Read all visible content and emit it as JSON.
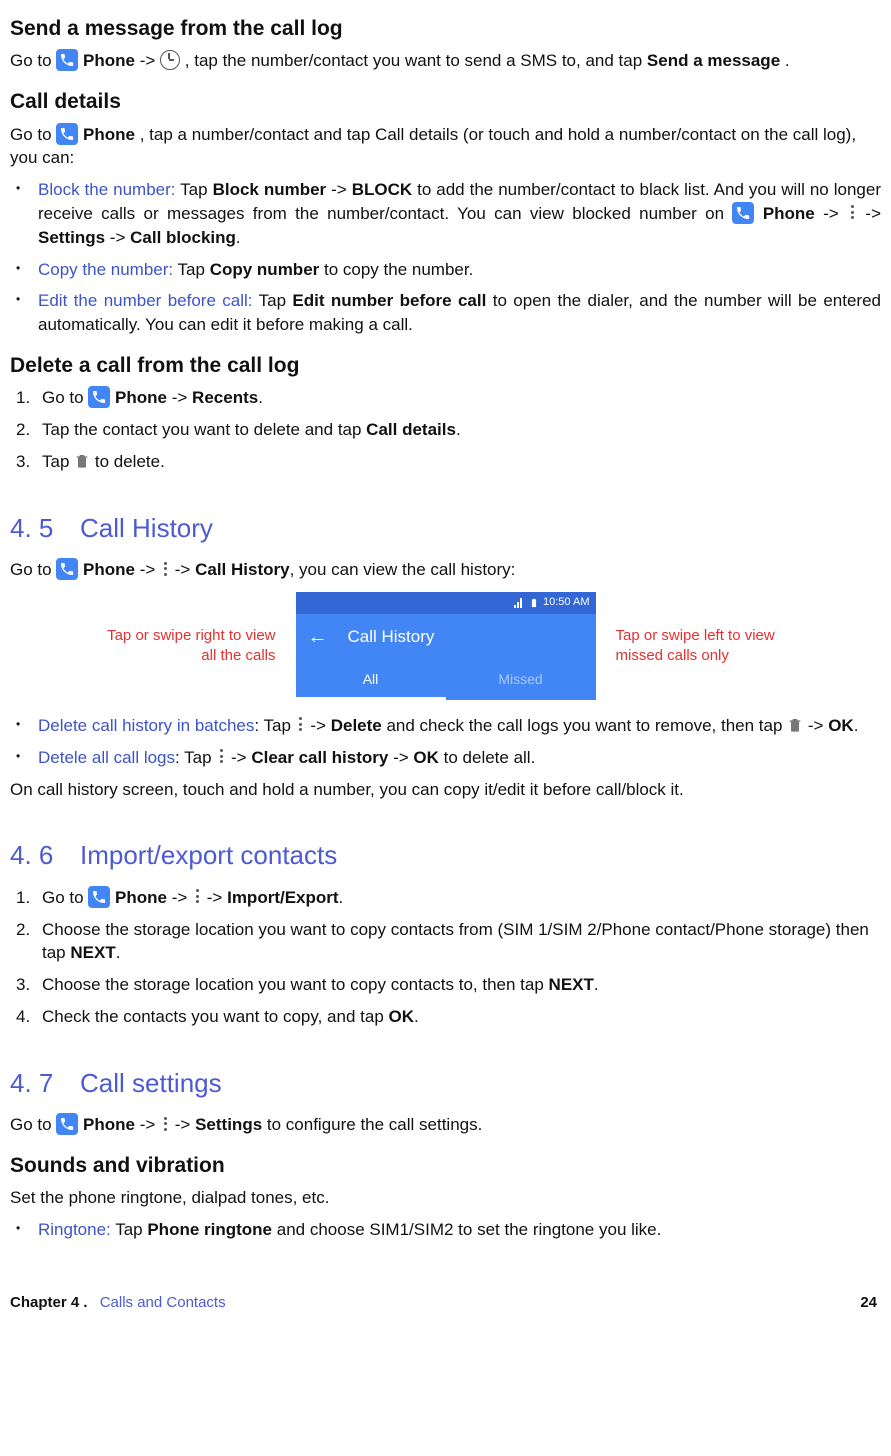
{
  "h_send": "Send a message from the call log",
  "send_p_1": "Go to ",
  "send_p_2": " -> ",
  "send_p_3": ", tap the number/contact you want to send a SMS to, and tap ",
  "send_p_4": ".",
  "phone_label": "Phone",
  "send_message": "Send a message",
  "h_call_details": "Call details",
  "cd_p_1": "Go to ",
  "cd_p_2": ", tap a number/contact and tap Call details (or touch and hold a number/contact on the call log), you can:",
  "cd_block_term": "Block the number:",
  "cd_block_1": " Tap ",
  "cd_block_bn": "Block number",
  "cd_block_2": " -> ",
  "cd_block_BLOCK": "BLOCK",
  "cd_block_3": " to add the number/contact to black list. And you will no longer receive calls or messages from the number/contact. You can view blocked number on ",
  "cd_block_4": " -> ",
  "cd_block_5": " -> ",
  "cd_block_settings": "Settings",
  "cd_block_6": " -> ",
  "cd_block_cb": "Call blocking",
  "cd_block_7": ".",
  "cd_copy_term": "Copy the number:",
  "cd_copy_1": " Tap ",
  "cd_copy_cn": "Copy number",
  "cd_copy_2": " to copy the number.",
  "cd_edit_term": "Edit the number before call:",
  "cd_edit_1": " Tap ",
  "cd_edit_en": "Edit number before call",
  "cd_edit_2": " to open the dialer, and the number will be entered automatically. You can edit it before making a call.",
  "h_delete": "Delete a call from the call log",
  "del_1a": "Go to ",
  "del_1b": " -> ",
  "del_1c": ".",
  "recents": "Recents",
  "del_2a": "Tap the contact you want to delete and tap ",
  "del_2b": ".",
  "call_details_b": "Call details",
  "del_3a": "Tap ",
  "del_3b": " to delete.",
  "sec45_num": "4. 5",
  "sec45_title": "Call History",
  "ch_p_1": "Go to ",
  "ch_p_2": " -> ",
  "ch_p_3": " -> ",
  "ch_bold": "Call History",
  "ch_p_4": ", you can view the call history:",
  "cap_left": "Tap or swipe right to view all the calls",
  "cap_right": "Tap or swipe left to view missed calls only",
  "shot_time": "10:50 AM",
  "shot_title": "Call History",
  "shot_tab_all": "All",
  "shot_tab_missed": "Missed",
  "ch_b1_term": "Delete call history in batches",
  "ch_b1_1": ": Tap ",
  "ch_b1_2": " -> ",
  "ch_b1_del": "Delete",
  "ch_b1_3": " and check the call logs you want to remove, then tap ",
  "ch_b1_4": " -> ",
  "ch_b1_ok": "OK",
  "ch_b1_5": ".",
  "ch_b2_term": "Detele all call logs",
  "ch_b2_1": ": Tap ",
  "ch_b2_2": " -> ",
  "ch_b2_cl": "Clear call history",
  "ch_b2_3": " -> ",
  "ch_b2_ok": "OK",
  "ch_b2_4": " to delete all.",
  "ch_last": "On call history screen, touch and hold a number, you can copy it/edit it before call/block it.",
  "sec46_num": "4. 6",
  "sec46_title": "Import/export contacts",
  "ie_1a": "Go to ",
  "ie_1b": " -> ",
  "ie_1c": " -> ",
  "ie_bold": "Import/Export",
  "ie_1d": ".",
  "ie_2a": "Choose the storage location you want to copy contacts from (SIM 1/SIM 2/Phone contact/Phone storage) then tap ",
  "ie_next": "NEXT",
  "ie_2b": ".",
  "ie_3a": "Choose the storage location you want to copy contacts to, then tap ",
  "ie_3b": ".",
  "ie_4a": "Check the contacts you want to copy, and tap ",
  "ie_ok": "OK",
  "ie_4b": ".",
  "sec47_num": "4. 7",
  "sec47_title": "Call settings",
  "cs_p_1": "Go to ",
  "cs_p_2": " -> ",
  "cs_p_3": " -> ",
  "cs_settings": "Settings",
  "cs_p_4": " to configure the call settings.",
  "h_sv": "Sounds and vibration",
  "sv_p": "Set the phone ringtone, dialpad tones, etc.",
  "sv_b1_term": "Ringtone:",
  "sv_b1_1": " Tap ",
  "sv_b1_pr": "Phone ringtone",
  "sv_b1_2": " and choose SIM1/SIM2 to set the ringtone you like.",
  "footer_chap": "Chapter 4 .",
  "footer_title": "Calls and Contacts",
  "footer_page": "24"
}
